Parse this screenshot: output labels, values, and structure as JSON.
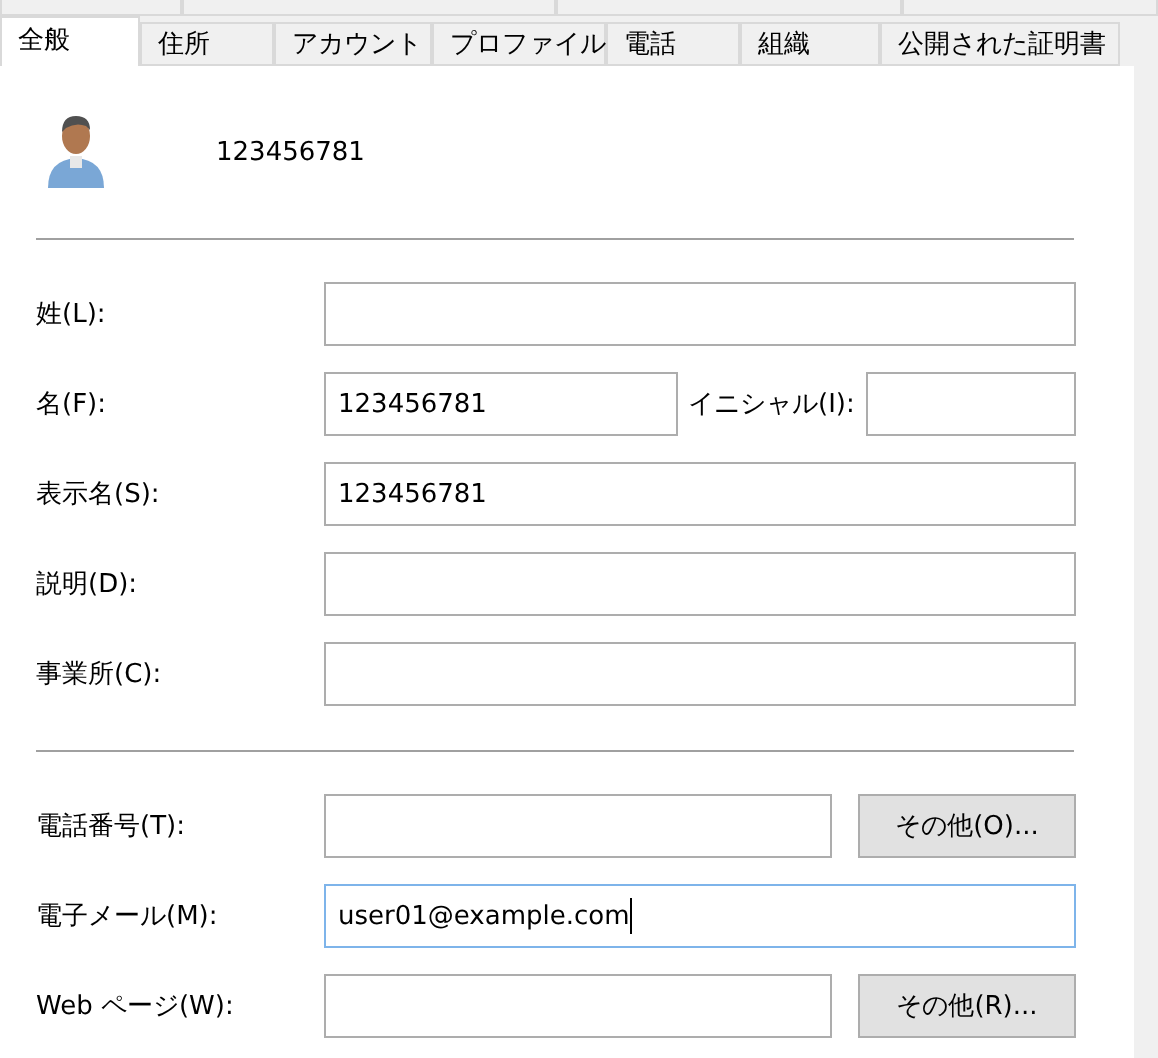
{
  "tabs": [
    {
      "label": "全般",
      "selected": true
    },
    {
      "label": "住所",
      "selected": false
    },
    {
      "label": "アカウント",
      "selected": false
    },
    {
      "label": "プロファイル",
      "selected": false
    },
    {
      "label": "電話",
      "selected": false
    },
    {
      "label": "組織",
      "selected": false
    },
    {
      "label": "公開された証明書",
      "selected": false
    }
  ],
  "header": {
    "name": "123456781"
  },
  "sections": [
    {
      "fields": [
        {
          "kind": "text",
          "label": "姓(L):"
        },
        {
          "kind": "pair",
          "label": "名(F):",
          "value": "123456781",
          "second_label": "イニシャル(I):"
        },
        {
          "kind": "text",
          "label": "表示名(S):",
          "value": "123456781"
        },
        {
          "kind": "text",
          "label": "説明(D):"
        },
        {
          "kind": "text",
          "label": "事業所(C):"
        }
      ]
    },
    {
      "fields": [
        {
          "kind": "button",
          "label": "電話番号(T):",
          "button": "その他(O)..."
        },
        {
          "kind": "text",
          "label": "電子メール(M):",
          "value": "user01@example.com",
          "focused": true
        },
        {
          "kind": "button",
          "label": "Web ページ(W):",
          "button": "その他(R)..."
        }
      ]
    }
  ]
}
